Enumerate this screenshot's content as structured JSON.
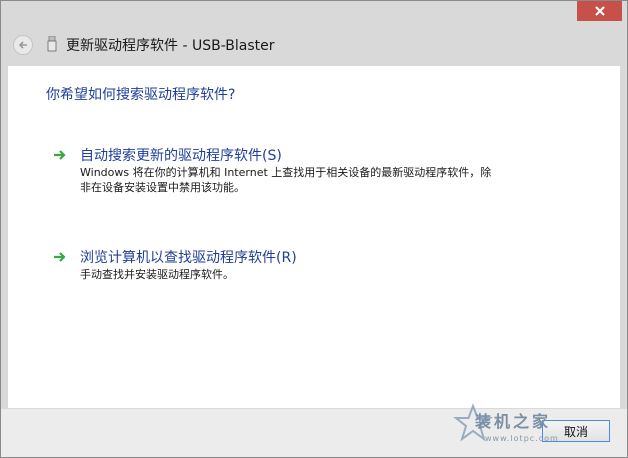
{
  "window": {
    "title": "更新驱动程序软件 - USB-Blaster",
    "close_icon": "close-icon",
    "back_icon": "back-arrow-icon",
    "device_icon": "usb-device-icon"
  },
  "main": {
    "heading": "你希望如何搜索驱动程序软件?",
    "options": [
      {
        "title": "自动搜索更新的驱动程序软件(S)",
        "description": "Windows 将在你的计算机和 Internet 上查找用于相关设备的最新驱动程序软件，除非在设备安装设置中禁用该功能。",
        "icon": "green-arrow-icon"
      },
      {
        "title": "浏览计算机以查找驱动程序软件(R)",
        "description": "手动查找并安装驱动程序软件。",
        "icon": "green-arrow-icon"
      }
    ]
  },
  "footer": {
    "cancel_label": "取消"
  },
  "watermark": {
    "text": "装机之家",
    "url": "www.lotpc.com"
  },
  "colors": {
    "accent_text": "#1f3f9a",
    "close_button": "#c7504a",
    "arrow_green": "#3aa845"
  }
}
